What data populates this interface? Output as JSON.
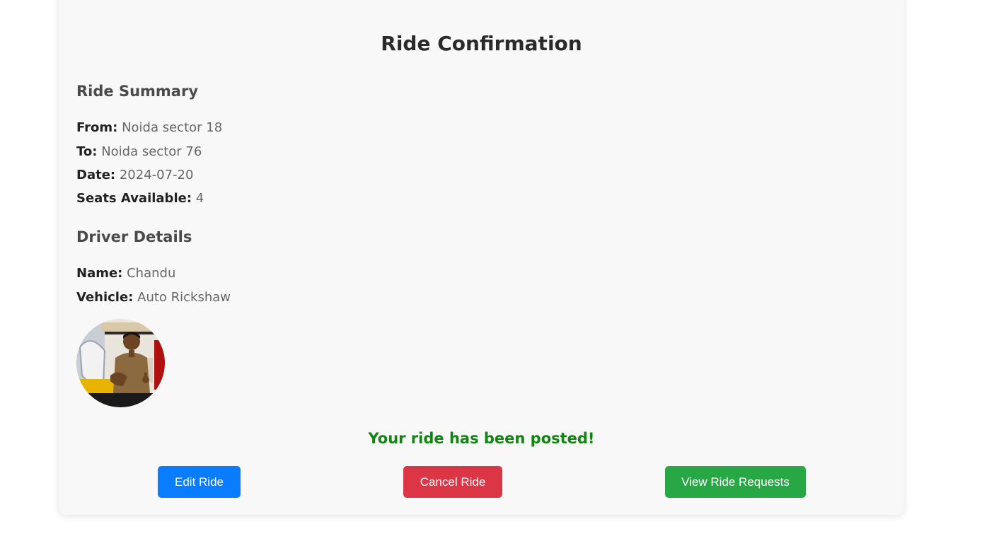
{
  "page": {
    "title": "Ride Confirmation"
  },
  "ride_summary": {
    "heading": "Ride Summary",
    "from_label": "From:",
    "from_value": "Noida sector 18",
    "to_label": "To:",
    "to_value": "Noida sector 76",
    "date_label": "Date:",
    "date_value": "2024-07-20",
    "seats_label": "Seats Available:",
    "seats_value": "4"
  },
  "driver_details": {
    "heading": "Driver Details",
    "name_label": "Name:",
    "name_value": "Chandu",
    "vehicle_label": "Vehicle:",
    "vehicle_value": "Auto Rickshaw",
    "photo_alt": "driver-photo"
  },
  "status": {
    "message": "Your ride has been posted!",
    "color": "#118411"
  },
  "actions": {
    "edit_label": "Edit Ride",
    "cancel_label": "Cancel Ride",
    "view_requests_label": "View Ride Requests"
  },
  "colors": {
    "edit_button": "#0a7cff",
    "cancel_button": "#dc3545",
    "view_requests_button": "#28a745",
    "card_background": "#f8f8f8"
  }
}
